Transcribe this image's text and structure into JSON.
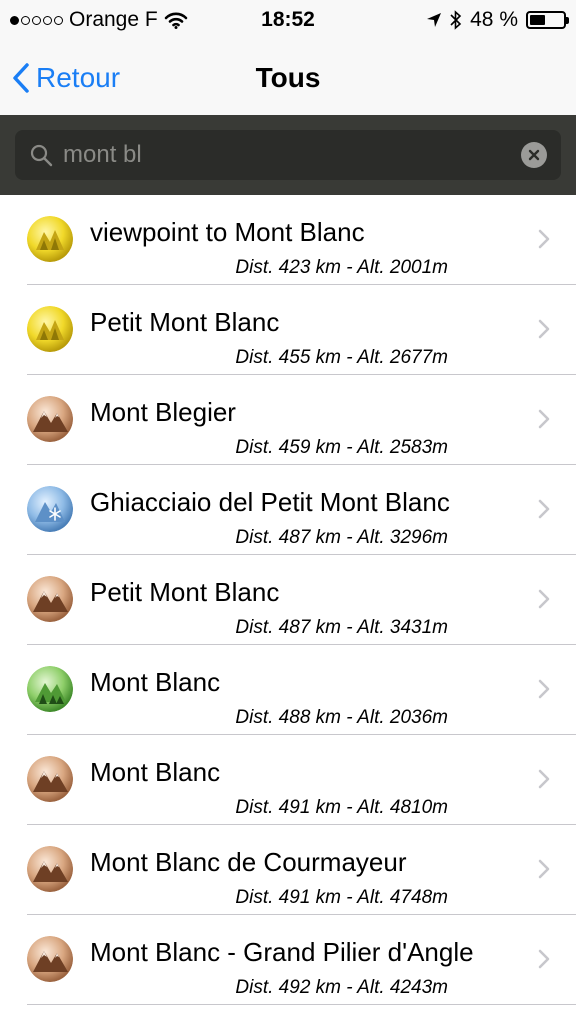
{
  "status_bar": {
    "carrier": "Orange F",
    "time": "18:52",
    "battery": "48 %",
    "battery_level": 0.48
  },
  "nav": {
    "back_label": "Retour",
    "title": "Tous"
  },
  "search": {
    "value": "mont bl"
  },
  "colors": {
    "accent": "#1a7ef5",
    "search_bg": "#393a36"
  },
  "results": [
    {
      "name": "viewpoint to Mont Blanc",
      "detail": "Dist. 423 km - Alt. 2001m",
      "icon": "viewpoint-yellow-icon"
    },
    {
      "name": "Petit Mont Blanc",
      "detail": "Dist. 455 km - Alt. 2677m",
      "icon": "viewpoint-yellow-icon"
    },
    {
      "name": "Mont Blegier",
      "detail": "Dist. 459 km - Alt. 2583m",
      "icon": "mountain-peak-icon"
    },
    {
      "name": "Ghiacciaio del Petit Mont Blanc",
      "detail": "Dist. 487 km - Alt. 3296m",
      "icon": "glacier-icon"
    },
    {
      "name": "Petit Mont Blanc",
      "detail": "Dist. 487 km - Alt. 3431m",
      "icon": "mountain-peak-icon"
    },
    {
      "name": "Mont Blanc",
      "detail": "Dist. 488 km - Alt. 2036m",
      "icon": "forest-hill-icon"
    },
    {
      "name": "Mont Blanc",
      "detail": "Dist. 491 km - Alt. 4810m",
      "icon": "mountain-peak-icon"
    },
    {
      "name": "Mont Blanc de Courmayeur",
      "detail": "Dist. 491 km - Alt. 4748m",
      "icon": "mountain-peak-icon"
    },
    {
      "name": "Mont Blanc - Grand Pilier d'Angle",
      "detail": "Dist. 492 km - Alt. 4243m",
      "icon": "mountain-peak-icon"
    }
  ]
}
